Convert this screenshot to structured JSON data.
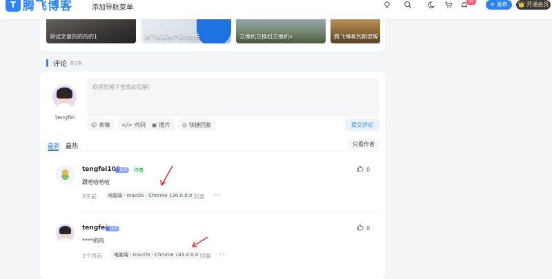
{
  "header": {
    "logo_mark": "T",
    "logo_text": "腾飞博客",
    "nav_add": "添加导航菜单",
    "icons": [
      "bulb-icon",
      "search-icon",
      "moon-icon",
      "cart-icon",
      "bell-icon"
    ],
    "notification_badge": "99",
    "publish_label": "✈ 发布",
    "vip_label": "👑 开通会员"
  },
  "related_posts": [
    {
      "caption": "测试文章的的的的1"
    },
    {
      "caption": "腾飞博客用户测试付费"
    },
    {
      "caption": "交换机交换机交换机v"
    },
    {
      "caption": "腾飞博客到期提醒"
    }
  ],
  "comments_section": {
    "title": "评论",
    "count": "共2条",
    "current_user": "tengfei",
    "placeholder": "欢迎您留下宝贵的见解!",
    "tools": [
      {
        "icon": "☺",
        "label": "表情"
      },
      {
        "icon": "</>",
        "label": "代码"
      },
      {
        "icon": "▣",
        "label": "图片"
      },
      {
        "icon": "◎",
        "label": "快捷回复"
      }
    ],
    "submit_label": "提交评论",
    "tabs": [
      "最新",
      "最热"
    ],
    "author_only_label": "只看作者"
  },
  "comments": [
    {
      "name": "tengfei106",
      "level": "LV.0",
      "author_tag": "作者",
      "text": "跟哈哈哈哈",
      "time": "8天前",
      "device": "电脑端 · macOS · Chrome 130.0.0.0",
      "reply": "回复",
      "more": "···",
      "likes": "0"
    },
    {
      "name": "tengfei",
      "level": "LV.0",
      "text": "****的的",
      "time": "2个月前",
      "device": "电脑端 · macOS · Chrome 143.0.0.0",
      "reply": "回复",
      "more": "···",
      "likes": "0"
    }
  ],
  "colors": {
    "accent": "#2d82f4",
    "annotation_arrow": "#e8313a"
  }
}
